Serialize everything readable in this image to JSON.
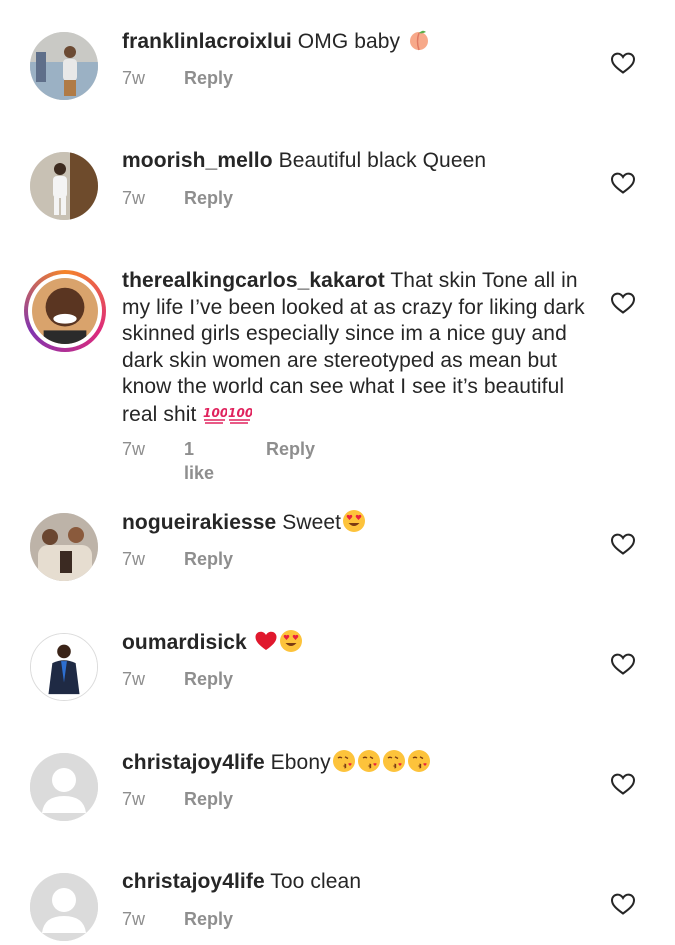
{
  "comments": [
    {
      "username": "franklinlacroixlui",
      "text": "OMG baby",
      "emojis": [
        "peach"
      ],
      "time": "7w",
      "likes": "",
      "reply": "Reply"
    },
    {
      "username": "moorish_mello",
      "text": "Beautiful black Queen",
      "emojis": [],
      "time": "7w",
      "likes": "",
      "reply": "Reply"
    },
    {
      "username": "therealkingcarlos_kakarot",
      "text": "That skin Tone all in my life I’ve been looked at as crazy for liking dark skinned girls especially since im a nice guy and dark skin women are stereotyped as mean but know the world can see what I see it’s beautiful real shit",
      "emojis": [
        "hundred",
        "hundred"
      ],
      "time": "7w",
      "likes": "1 like",
      "reply": "Reply"
    },
    {
      "username": "nogueirakiesse",
      "text": "Sweet",
      "emojis": [
        "heart-eyes"
      ],
      "time": "7w",
      "likes": "",
      "reply": "Reply"
    },
    {
      "username": "oumardisick",
      "text": "",
      "emojis": [
        "red-heart",
        "heart-eyes"
      ],
      "time": "7w",
      "likes": "",
      "reply": "Reply"
    },
    {
      "username": "christajoy4life",
      "text": "Ebony",
      "emojis": [
        "kissing-heart",
        "kissing-heart",
        "kissing-heart",
        "kissing-heart"
      ],
      "time": "7w",
      "likes": "",
      "reply": "Reply"
    },
    {
      "username": "christajoy4life",
      "text": "Too clean",
      "emojis": [],
      "time": "7w",
      "likes": "",
      "reply": "Reply"
    }
  ],
  "icons": {
    "like": "heart-outline-icon"
  },
  "colors": {
    "text": "#262626",
    "meta": "#8e8e8e",
    "heart": "#262626"
  }
}
